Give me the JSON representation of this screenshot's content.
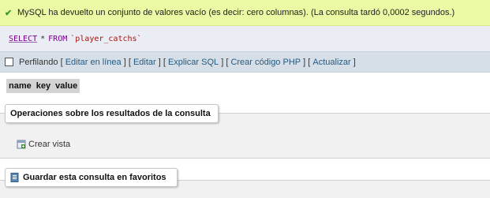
{
  "success": {
    "icon": "check-icon",
    "message": "MySQL ha devuelto un conjunto de valores vacío (es decir: cero columnas). (La consulta tardó 0,0002 segundos.)"
  },
  "query": {
    "select_kw": "SELECT",
    "star": "*",
    "from_kw": "FROM",
    "table": "`player_catchs`"
  },
  "toolbar": {
    "profiling": "Perfilando",
    "links": [
      "Editar en línea",
      "Editar",
      "Explicar SQL",
      "Crear código PHP",
      "Actualizar"
    ]
  },
  "columns": [
    "name",
    "key",
    "value"
  ],
  "operations": {
    "legend": "Operaciones sobre los resultados de la consulta",
    "create_view": "Crear vista",
    "create_view_icon": "create-view-icon"
  },
  "bookmark": {
    "legend": "Guardar esta consulta en favoritos",
    "icon": "bookmark-icon"
  },
  "colors": {
    "success_bg": "#ebf8a4",
    "link": "#235a81",
    "toolbar_bg": "#d6dfe8"
  }
}
